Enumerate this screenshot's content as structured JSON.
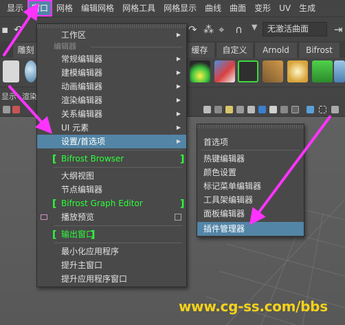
{
  "menubar": {
    "items": [
      {
        "label": "显示"
      },
      {
        "label": "窗口",
        "active": true
      },
      {
        "label": "网格"
      },
      {
        "label": "编辑网格"
      },
      {
        "label": "网格工具"
      },
      {
        "label": "网格显示"
      },
      {
        "label": "曲线"
      },
      {
        "label": "曲面"
      },
      {
        "label": "变形"
      },
      {
        "label": "UV"
      },
      {
        "label": "生成"
      }
    ]
  },
  "statusline": {
    "no_active_surface": "无激活曲面"
  },
  "shelf": {
    "tabs": [
      "雕刻",
      "缓存",
      "自定义",
      "Arnold",
      "Bifrost"
    ]
  },
  "panel": {
    "left_labels": [
      "显示",
      "渲染"
    ]
  },
  "window_menu": {
    "items": [
      {
        "label": "工作区",
        "submenu": true
      },
      {
        "section": "编辑器"
      },
      {
        "label": "常规编辑器",
        "submenu": true
      },
      {
        "label": "建模编辑器",
        "submenu": true
      },
      {
        "label": "动画编辑器",
        "submenu": true
      },
      {
        "label": "渲染编辑器",
        "submenu": true
      },
      {
        "label": "关系编辑器",
        "submenu": true
      },
      {
        "label": "UI 元素",
        "submenu": true
      },
      {
        "label": "设置/首选项",
        "submenu": true,
        "selected": true
      },
      {
        "label": "Bifrost Browser",
        "bracketed": true
      },
      {
        "label": "大纲视图"
      },
      {
        "label": "节点编辑器"
      },
      {
        "label": "Bifrost Graph Editor",
        "bracketed": true
      },
      {
        "label": "播放预览",
        "checkbox": true
      },
      {
        "label": "输出窗口",
        "bracketed": true
      },
      {
        "label": "最小化应用程序"
      },
      {
        "label": "提升主窗口"
      },
      {
        "label": "提升应用程序窗口"
      }
    ]
  },
  "settings_submenu": {
    "items": [
      {
        "label": "首选项"
      },
      {
        "label": "热键编辑器"
      },
      {
        "label": "颜色设置"
      },
      {
        "label": "标记菜单编辑器"
      },
      {
        "label": "工具架编辑器"
      },
      {
        "label": "面板编辑器"
      },
      {
        "label": "插件管理器",
        "selected": true
      }
    ]
  },
  "watermark": "www.cg-ss.com/bbs",
  "colors": {
    "highlight": "#5285a6",
    "annotation_arrow": "#ff33ff",
    "bracket_green": "#2dff3a",
    "watermark": "#f5d21a"
  }
}
